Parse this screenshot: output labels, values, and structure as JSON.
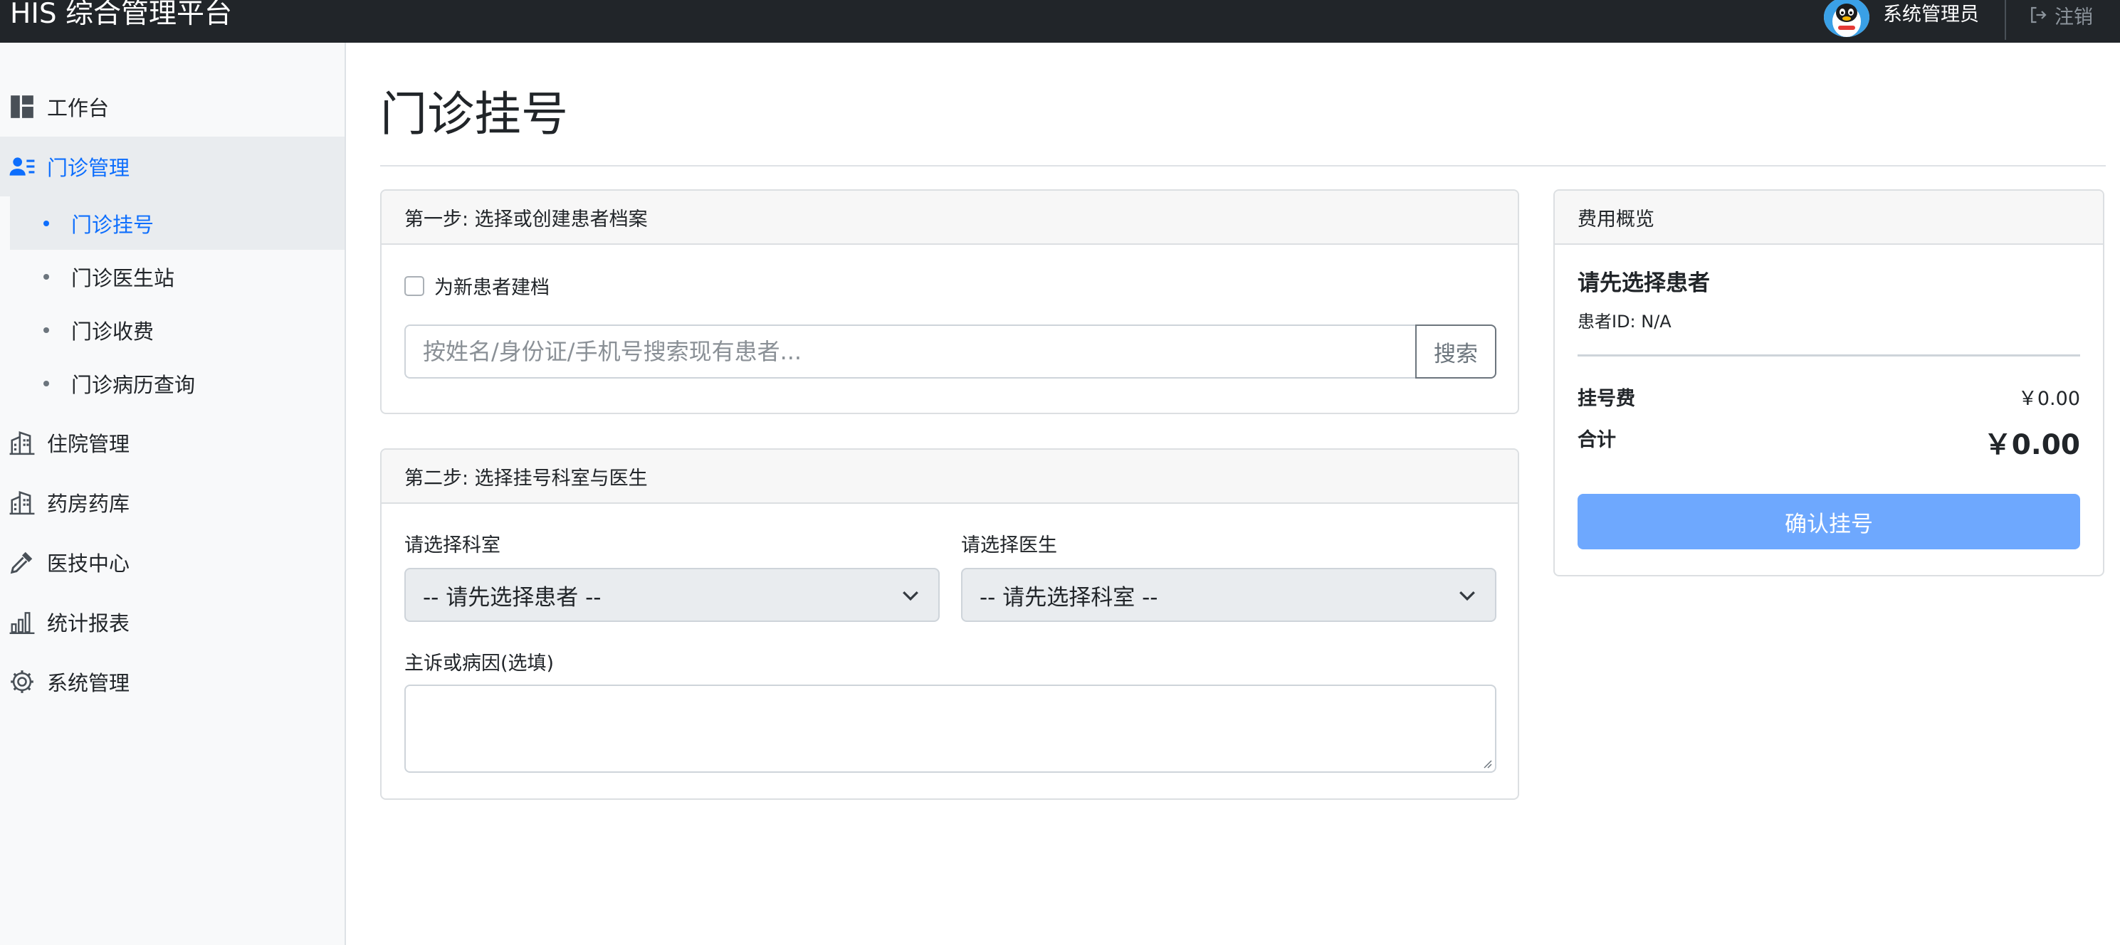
{
  "app": {
    "brand": "HIS 综合管理平台",
    "user_name": "系统管理员",
    "logout_label": "注销"
  },
  "sidebar": {
    "items": [
      {
        "label": "工作台",
        "icon": "dashboard-icon"
      },
      {
        "label": "门诊管理",
        "icon": "people-list-icon",
        "active": true
      },
      {
        "label": "住院管理",
        "icon": "building-icon"
      },
      {
        "label": "药房药库",
        "icon": "building-icon"
      },
      {
        "label": "医技中心",
        "icon": "eyedropper-icon"
      },
      {
        "label": "统计报表",
        "icon": "bar-chart-icon"
      },
      {
        "label": "系统管理",
        "icon": "gear-icon"
      }
    ],
    "sub_items": [
      {
        "label": "门诊挂号",
        "active": true
      },
      {
        "label": "门诊医生站"
      },
      {
        "label": "门诊收费"
      },
      {
        "label": "门诊病历查询"
      }
    ]
  },
  "main": {
    "title": "门诊挂号",
    "step1": {
      "header": "第一步: 选择或创建患者档案",
      "new_patient_label": "为新患者建档",
      "search_placeholder": "按姓名/身份证/手机号搜索现有患者...",
      "search_button": "搜索"
    },
    "step2": {
      "header": "第二步: 选择挂号科室与医生",
      "dept_label": "请选择科室",
      "dept_value": "-- 请先选择患者 --",
      "doctor_label": "请选择医生",
      "doctor_value": "-- 请先选择科室 --",
      "complaint_label": "主诉或病因(选填)"
    },
    "fee": {
      "header": "费用概览",
      "patient_prompt": "请先选择患者",
      "patient_id": "患者ID: N/A",
      "reg_fee_label": "挂号费",
      "reg_fee_value": "￥0.00",
      "total_label": "合计",
      "total_value": "￥0.00",
      "confirm_button": "确认挂号"
    }
  },
  "colors": {
    "topbar": "#212529",
    "accent": "#0d6efd",
    "confirm_button": "#6ea8fe",
    "sidebar_bg": "#f8f9fa"
  }
}
